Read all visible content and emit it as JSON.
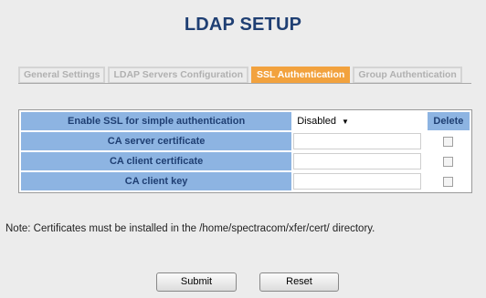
{
  "page": {
    "title": "LDAP SETUP"
  },
  "tabs": [
    {
      "label": "General Settings",
      "active": false
    },
    {
      "label": "LDAP Servers Configuration",
      "active": false
    },
    {
      "label": "SSL Authentication",
      "active": true
    },
    {
      "label": "Group Authentication",
      "active": false
    }
  ],
  "table": {
    "delete_header": "Delete",
    "rows": [
      {
        "label": "Enable SSL for simple authentication",
        "value": "Disabled"
      },
      {
        "label": "CA server certificate",
        "value": ""
      },
      {
        "label": "CA client certificate",
        "value": ""
      },
      {
        "label": "CA client key",
        "value": ""
      }
    ]
  },
  "note": "Note: Certificates must be installed in the /home/spectracom/xfer/cert/ directory.",
  "buttons": {
    "submit": "Submit",
    "reset": "Reset"
  },
  "colors": {
    "title": "#1f3f73",
    "label_bg": "#8db4e2",
    "active_tab": "#f2a23e",
    "inactive_tab_text": "#b0b0b0"
  }
}
